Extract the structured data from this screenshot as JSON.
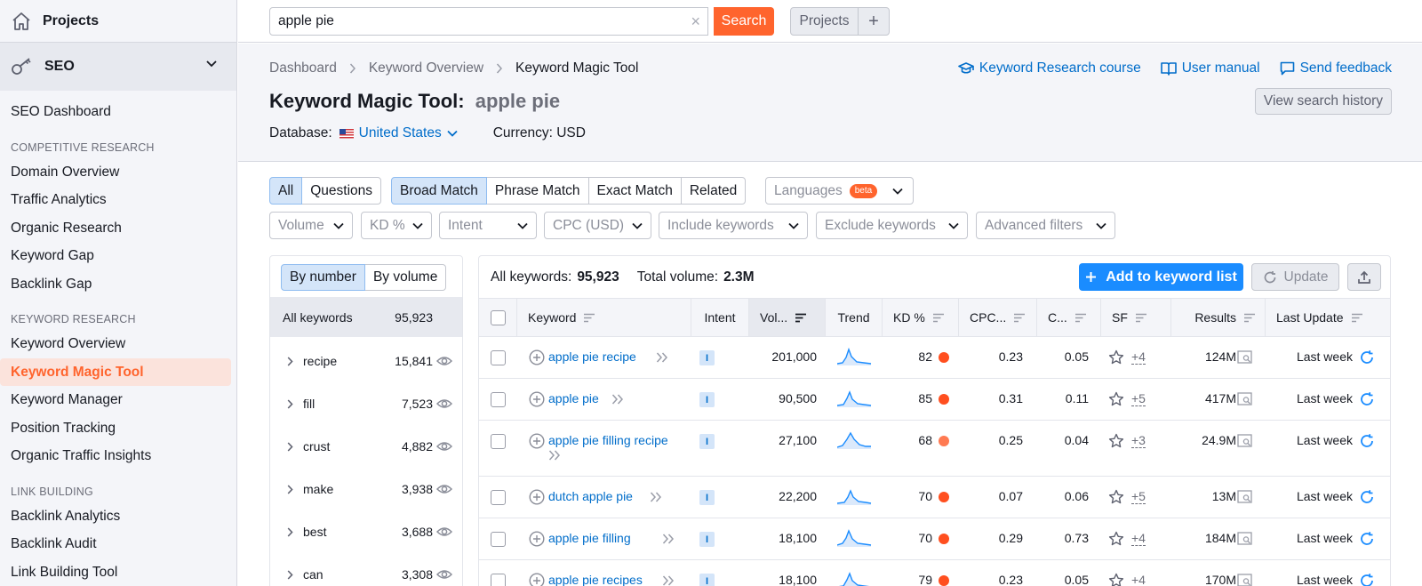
{
  "sidebar": {
    "projects_label": "Projects",
    "seo_label": "SEO",
    "dashboard": "SEO Dashboard",
    "sections": [
      {
        "title": "COMPETITIVE RESEARCH",
        "items": [
          "Domain Overview",
          "Traffic Analytics",
          "Organic Research",
          "Keyword Gap",
          "Backlink Gap"
        ]
      },
      {
        "title": "KEYWORD RESEARCH",
        "items": [
          "Keyword Overview",
          "Keyword Magic Tool",
          "Keyword Manager",
          "Position Tracking",
          "Organic Traffic Insights"
        ]
      },
      {
        "title": "LINK BUILDING",
        "items": [
          "Backlink Analytics",
          "Backlink Audit",
          "Link Building Tool"
        ]
      }
    ],
    "active_item": "Keyword Magic Tool"
  },
  "topbar": {
    "search_value": "apple pie",
    "search_button": "Search",
    "projects_button": "Projects",
    "plus": "+"
  },
  "header": {
    "breadcrumb": [
      "Dashboard",
      "Keyword Overview",
      "Keyword Magic Tool"
    ],
    "title": "Keyword Magic Tool:",
    "query": "apple pie",
    "database_label": "Database:",
    "database_value": "United States",
    "currency": "Currency: USD",
    "links": [
      "Keyword Research course",
      "User manual",
      "Send feedback"
    ],
    "history_button": "View search history"
  },
  "filters": {
    "type_tabs": [
      "All",
      "Questions"
    ],
    "match_tabs": [
      "Broad Match",
      "Phrase Match",
      "Exact Match",
      "Related"
    ],
    "languages": "Languages",
    "beta": "beta",
    "dropdowns": [
      "Volume",
      "KD %",
      "Intent",
      "CPC (USD)",
      "Include keywords",
      "Exclude keywords",
      "Advanced filters"
    ]
  },
  "groups": {
    "toggle": [
      "By number",
      "By volume"
    ],
    "all_label": "All keywords",
    "all_count": "95,923",
    "rows": [
      {
        "label": "recipe",
        "count": "15,841"
      },
      {
        "label": "fill",
        "count": "7,523"
      },
      {
        "label": "crust",
        "count": "4,882"
      },
      {
        "label": "make",
        "count": "3,938"
      },
      {
        "label": "best",
        "count": "3,688"
      },
      {
        "label": "can",
        "count": "3,308"
      }
    ]
  },
  "table": {
    "summary_label": "All keywords:",
    "summary_count": "95,923",
    "volume_label": "Total volume:",
    "volume_value": "2.3M",
    "add_button": "Add to keyword list",
    "update_button": "Update",
    "columns": [
      "Keyword",
      "Intent",
      "Vol...",
      "Trend",
      "KD %",
      "CPC...",
      "C...",
      "SF",
      "Results",
      "Last Update"
    ],
    "rows": [
      {
        "keyword": "apple pie recipe",
        "intent": "I",
        "volume": "201,000",
        "kd": "82",
        "cpc": "0.23",
        "com": "0.05",
        "sf": "+4",
        "results": "124M",
        "updated": "Last week"
      },
      {
        "keyword": "apple pie",
        "intent": "I",
        "volume": "90,500",
        "kd": "85",
        "cpc": "0.31",
        "com": "0.11",
        "sf": "+5",
        "results": "417M",
        "updated": "Last week"
      },
      {
        "keyword": "apple pie filling recipe",
        "intent": "I",
        "volume": "27,100",
        "kd": "68",
        "cpc": "0.25",
        "com": "0.04",
        "sf": "+3",
        "results": "24.9M",
        "updated": "Last week"
      },
      {
        "keyword": "dutch apple pie",
        "intent": "I",
        "volume": "22,200",
        "kd": "70",
        "cpc": "0.07",
        "com": "0.06",
        "sf": "+5",
        "results": "13M",
        "updated": "Last week"
      },
      {
        "keyword": "apple pie filling",
        "intent": "I",
        "volume": "18,100",
        "kd": "70",
        "cpc": "0.29",
        "com": "0.73",
        "sf": "+4",
        "results": "184M",
        "updated": "Last week"
      },
      {
        "keyword": "apple pie recipes",
        "intent": "I",
        "volume": "18,100",
        "kd": "79",
        "cpc": "0.23",
        "com": "0.05",
        "sf": "+4",
        "results": "170M",
        "updated": "Last week"
      }
    ]
  },
  "colors": {
    "accent": "#ff642d",
    "link": "#006dca",
    "primary_button": "#1a8cff",
    "kd_hard": "#ff4f1f",
    "kd_medium": "#ff7a52"
  }
}
